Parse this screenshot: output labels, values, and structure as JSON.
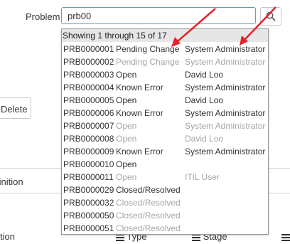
{
  "field": {
    "label": "Problem",
    "value": "prb00"
  },
  "icons": {
    "search": "search-icon",
    "column_menu": "hamburger-menu-icon"
  },
  "colors": {
    "focus_border": "#5b9bd5",
    "arrow": "#e8202a",
    "muted_text": "#a6a6a6",
    "header_bg": "#e6e6e6"
  },
  "background": {
    "delete_label": "Delete",
    "definition_label": "finition",
    "columns": {
      "first": "tion",
      "type": "Type",
      "stage": "Stage"
    }
  },
  "dropdown": {
    "summary": "Showing 1 through 15 of 17",
    "rows": [
      {
        "number": "PRB0000001",
        "state": "Pending Change",
        "assigned": "System Administrator",
        "muted": false
      },
      {
        "number": "PRB0000002",
        "state": "Pending Change",
        "assigned": "System Administrator",
        "muted": true
      },
      {
        "number": "PRB0000003",
        "state": "Open",
        "assigned": "David Loo",
        "muted": false
      },
      {
        "number": "PRB0000004",
        "state": "Known Error",
        "assigned": "System Administrator",
        "muted": false
      },
      {
        "number": "PRB0000005",
        "state": "Open",
        "assigned": "David Loo",
        "muted": false
      },
      {
        "number": "PRB0000006",
        "state": "Known Error",
        "assigned": "System Administrator",
        "muted": false
      },
      {
        "number": "PRB0000007",
        "state": "Open",
        "assigned": "System Administrator",
        "muted": true
      },
      {
        "number": "PRB0000008",
        "state": "Open",
        "assigned": "David Loo",
        "muted": true
      },
      {
        "number": "PRB0000009",
        "state": "Known Error",
        "assigned": "System Administrator",
        "muted": false
      },
      {
        "number": "PRB0000010",
        "state": "Open",
        "assigned": "",
        "muted": false
      },
      {
        "number": "PRB0000011",
        "state": "Open",
        "assigned": "ITIL User",
        "muted": true
      },
      {
        "number": "PRB0000029",
        "state": "Closed/Resolved",
        "assigned": "",
        "muted": false
      },
      {
        "number": "PRB0000032",
        "state": "Closed/Resolved",
        "assigned": "",
        "muted": true
      },
      {
        "number": "PRB0000050",
        "state": "Closed/Resolved",
        "assigned": "",
        "muted": true
      },
      {
        "number": "PRB0000051",
        "state": "Closed/Resolved",
        "assigned": "",
        "muted": true
      }
    ]
  }
}
